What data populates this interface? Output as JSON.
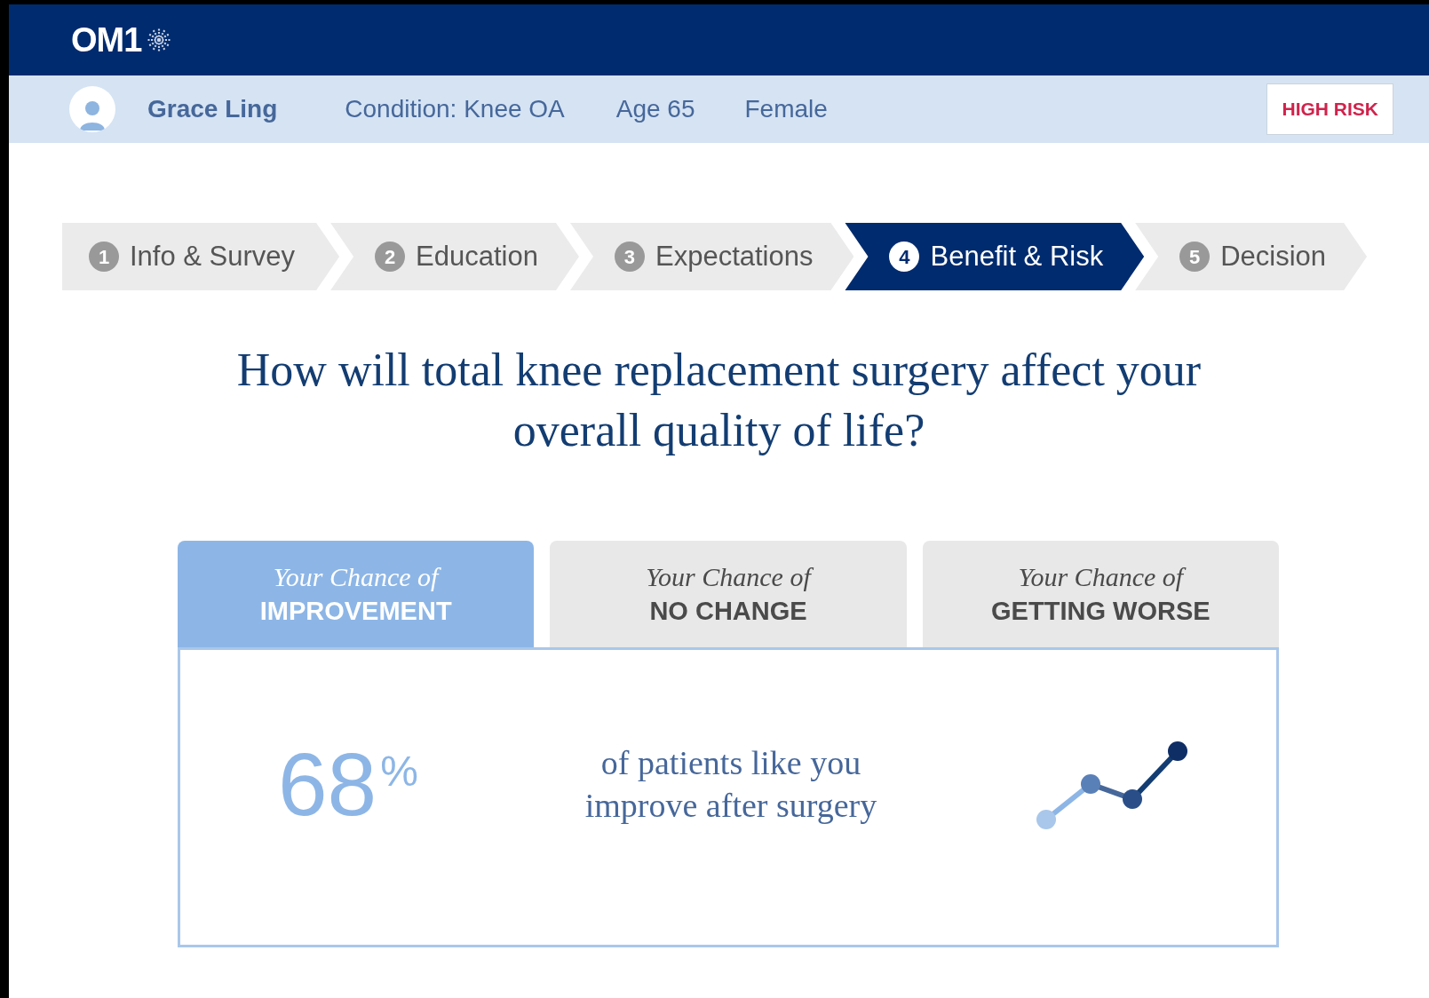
{
  "logo": {
    "text": "OM1"
  },
  "patient": {
    "name": "Grace Ling",
    "condition": "Condition: Knee OA",
    "age": "Age 65",
    "sex": "Female",
    "risk_badge": "HIGH RISK"
  },
  "steps": [
    {
      "number": "1",
      "label": "Info & Survey",
      "selected": false
    },
    {
      "number": "2",
      "label": "Education",
      "selected": false
    },
    {
      "number": "3",
      "label": "Expectations",
      "selected": false
    },
    {
      "number": "4",
      "label": "Benefit & Risk",
      "selected": true
    },
    {
      "number": "5",
      "label": "Decision",
      "selected": false
    }
  ],
  "question": "How will total knee replacement surgery affect your overall quality of life?",
  "outcome_tabs": [
    {
      "prefix": "Your Chance of",
      "label": "IMPROVEMENT",
      "selected": true
    },
    {
      "prefix": "Your Chance of",
      "label": "NO CHANGE",
      "selected": false
    },
    {
      "prefix": "Your Chance of",
      "label": "GETTING WORSE",
      "selected": false
    }
  ],
  "result": {
    "value": "68",
    "unit": "%",
    "description": "of patients like you improve after surgery"
  }
}
